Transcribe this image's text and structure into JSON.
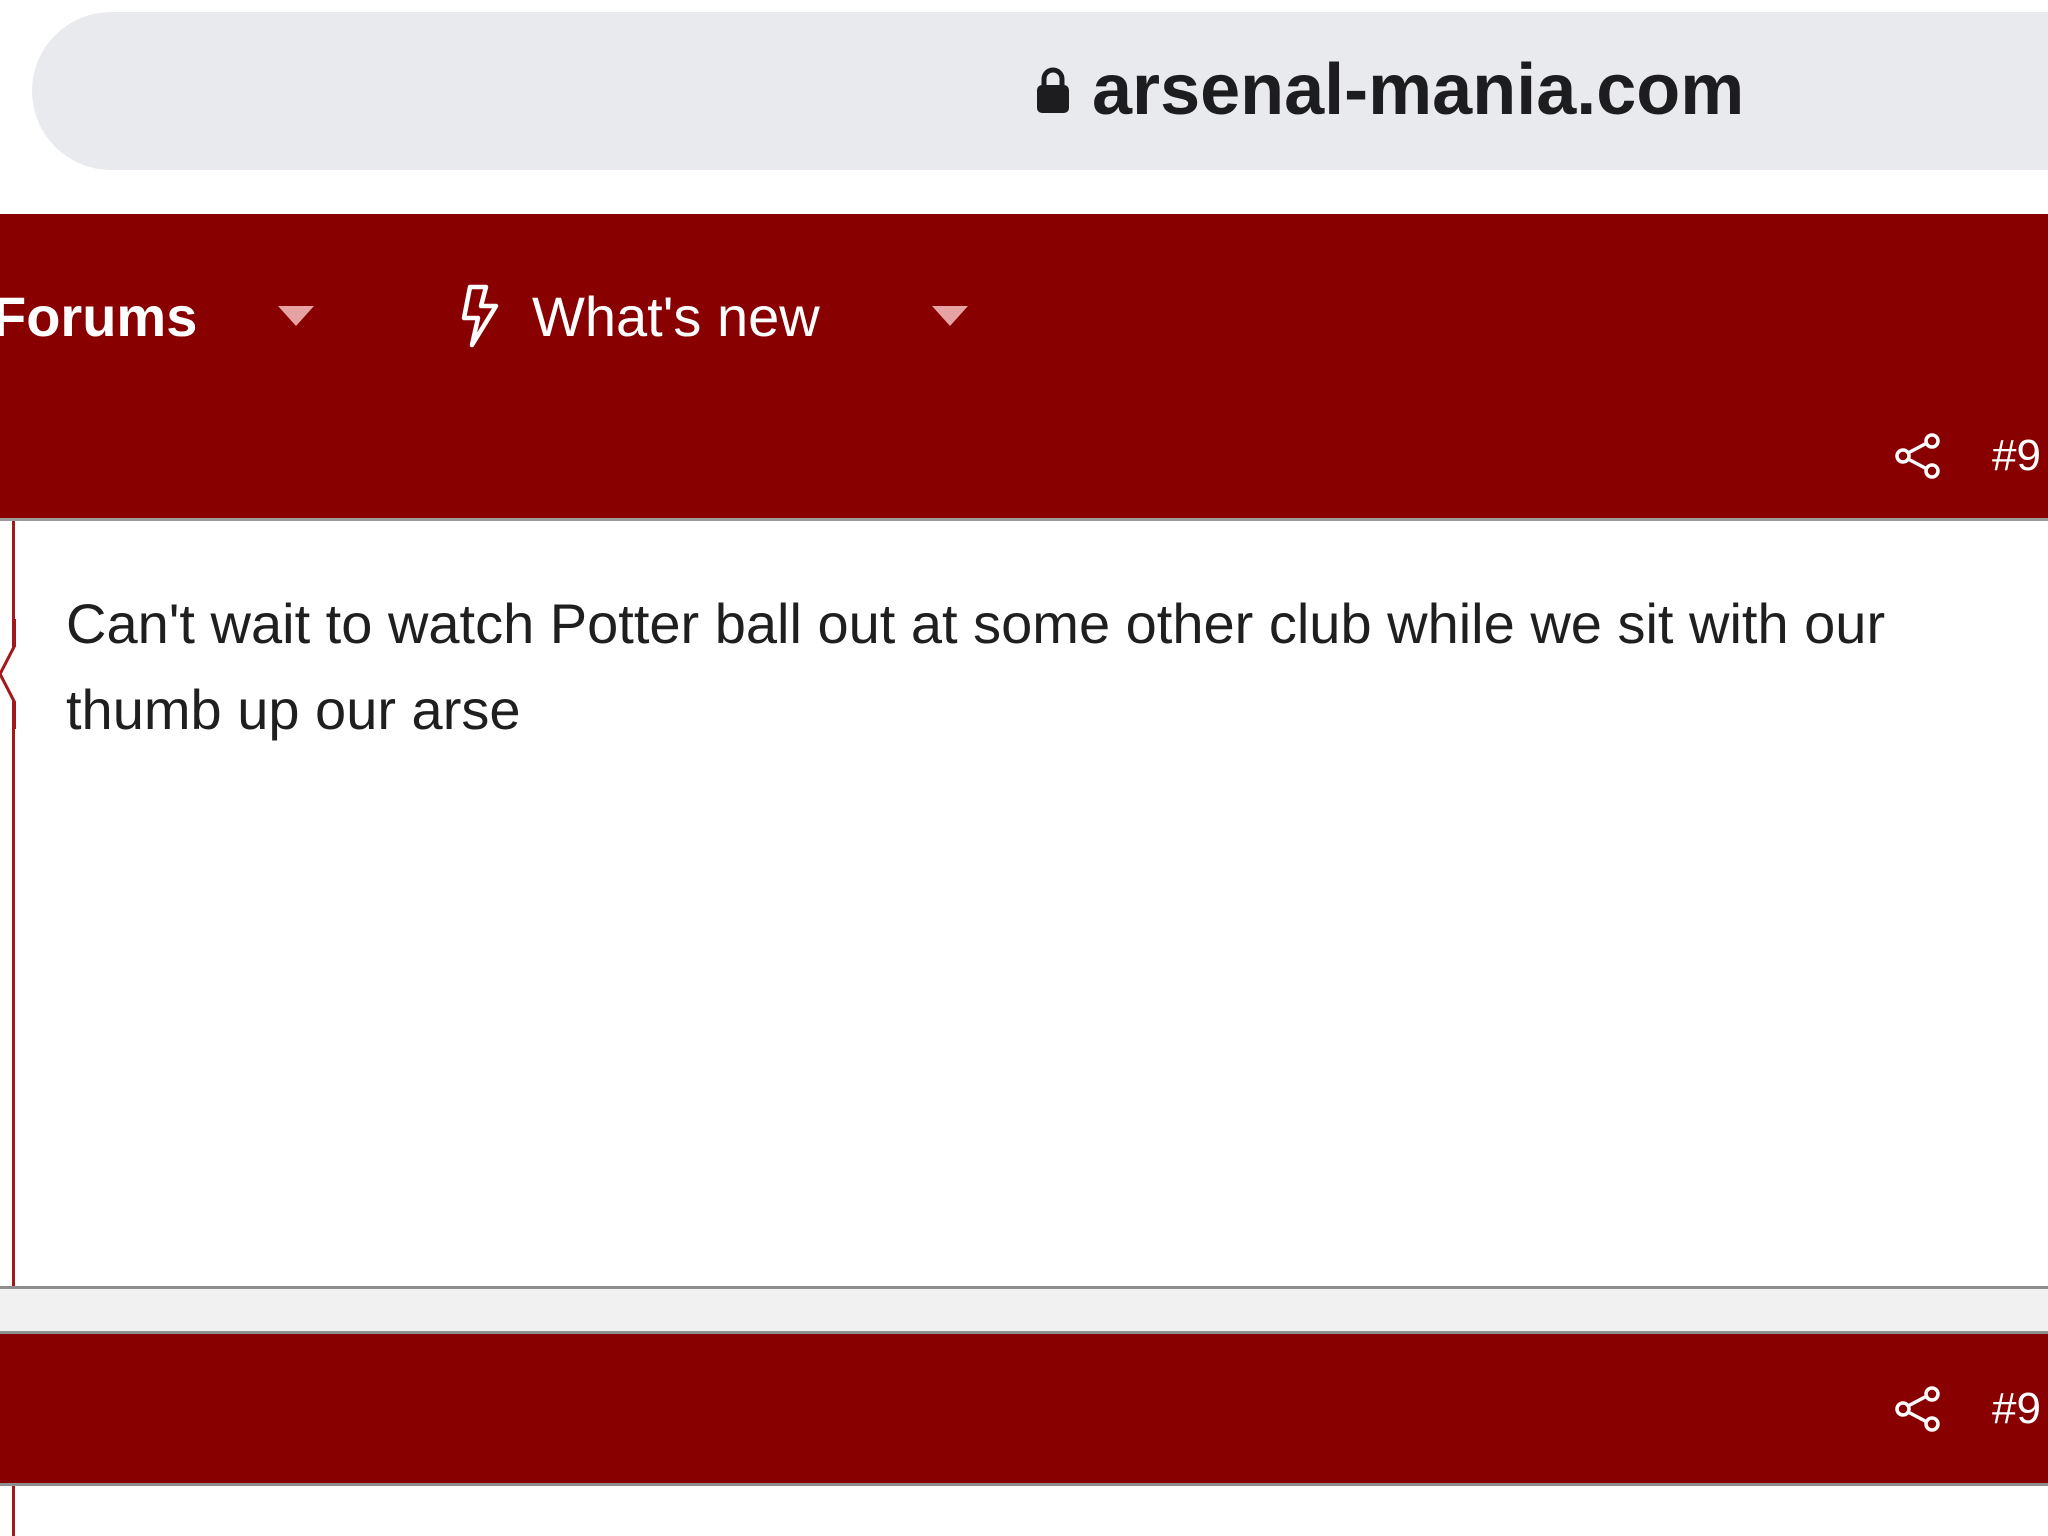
{
  "browser": {
    "url": "arsenal-mania.com",
    "lock_icon": "lock-icon"
  },
  "nav": {
    "items": [
      {
        "label": "Forums",
        "icon": "chevron-down-icon"
      },
      {
        "label": "What's new",
        "icon": "bolt-icon"
      }
    ]
  },
  "posts": [
    {
      "number": "#9",
      "share_icon": "share-icon",
      "text": "Can't wait to watch Potter ball out at some other club while we sit with our thumb up our arse"
    },
    {
      "number": "#9",
      "share_icon": "share-icon",
      "text": ""
    }
  ],
  "colors": {
    "brand": "#880000",
    "url_bar": "#e9eaed",
    "accent_rule": "#a31818"
  }
}
